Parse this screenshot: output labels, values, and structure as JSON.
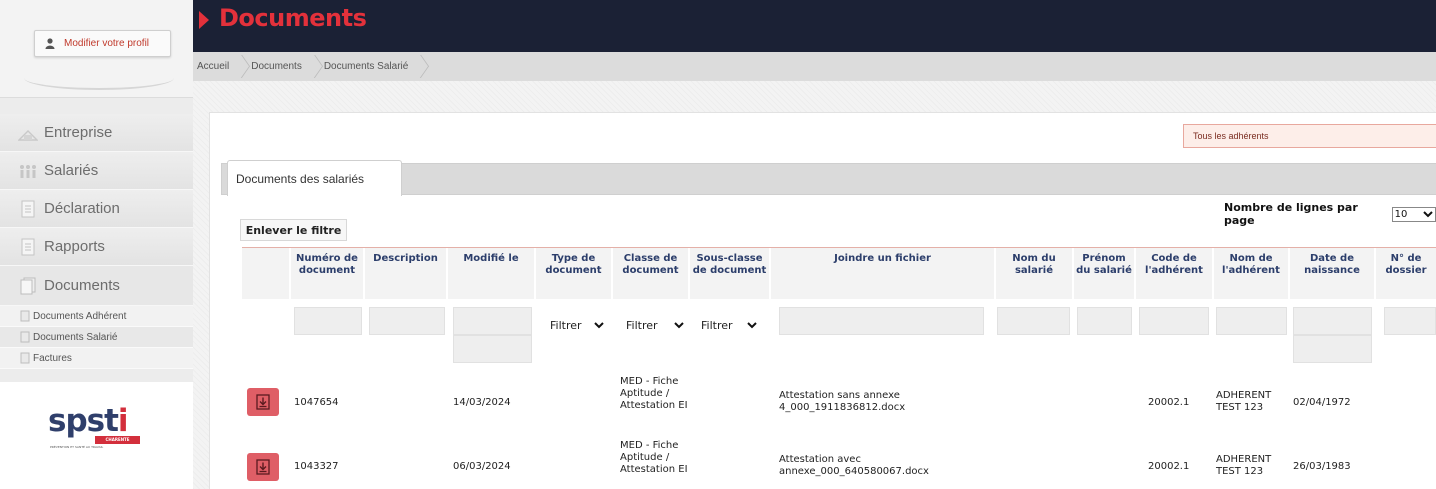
{
  "profile": {
    "button_label": "Modifier votre profil",
    "icon": "user-icon"
  },
  "nav": {
    "items": [
      {
        "label": "Entreprise",
        "icon": "building-icon"
      },
      {
        "label": "Salariés",
        "icon": "people-icon"
      },
      {
        "label": "Déclaration",
        "icon": "document-icon"
      },
      {
        "label": "Rapports",
        "icon": "document-icon"
      },
      {
        "label": "Documents",
        "icon": "documents-icon"
      }
    ],
    "sub_items": [
      {
        "label": "Documents Adhérent"
      },
      {
        "label": "Documents Salarié"
      },
      {
        "label": "Factures"
      }
    ]
  },
  "logo": {
    "text_main": "spst",
    "text_accent": "i",
    "text_sub": "CHARENTE",
    "text_tag": "PRÉVENTION ET SANTÉ AU TRAVAIL"
  },
  "header": {
    "title": "Documents",
    "accent_color": "#e3313b",
    "bar_color": "#1b2135"
  },
  "breadcrumb": [
    "Accueil",
    "Documents",
    "Documents Salarié"
  ],
  "filter_box": {
    "label": "Tous les adhérents"
  },
  "tabs": [
    {
      "label": "Documents des salariés"
    }
  ],
  "toolbar": {
    "remove_filter_label": "Enlever le filtre",
    "rows_per_page_label": "Nombre de lignes par page",
    "rows_per_page_value": "10"
  },
  "table": {
    "columns": [
      "Numéro de document",
      "Description",
      "Modifié le",
      "Type de document",
      "Classe de document",
      "Sous-classe de document",
      "Joindre un fichier",
      "Nom du salarié",
      "Prénom du salarié",
      "Code de l'adhérent",
      "Nom de l'adhérent",
      "Date de naissance",
      "N° de dossier"
    ],
    "filters": {
      "type": "Filtrer",
      "classe": "Filtrer",
      "sous_classe": "Filtrer"
    },
    "rows": [
      {
        "numero": "1047654",
        "description": "",
        "modifie": "14/03/2024",
        "type": "",
        "classe": "MED - Fiche Aptitude / Attestation EI",
        "sous_classe": "",
        "fichier": "Attestation sans annexe 4_000_1911836812.docx",
        "nom": "",
        "prenom": "",
        "code": "20002.1",
        "adherent": "ADHERENT TEST 123",
        "naissance": "02/04/1972",
        "dossier": ""
      },
      {
        "numero": "1043327",
        "description": "",
        "modifie": "06/03/2024",
        "type": "",
        "classe": "MED - Fiche Aptitude / Attestation EI",
        "sous_classe": "",
        "fichier": "Attestation avec annexe_000_640580067.docx",
        "nom": "",
        "prenom": "",
        "code": "20002.1",
        "adherent": "ADHERENT TEST 123",
        "naissance": "26/03/1983",
        "dossier": ""
      }
    ]
  }
}
